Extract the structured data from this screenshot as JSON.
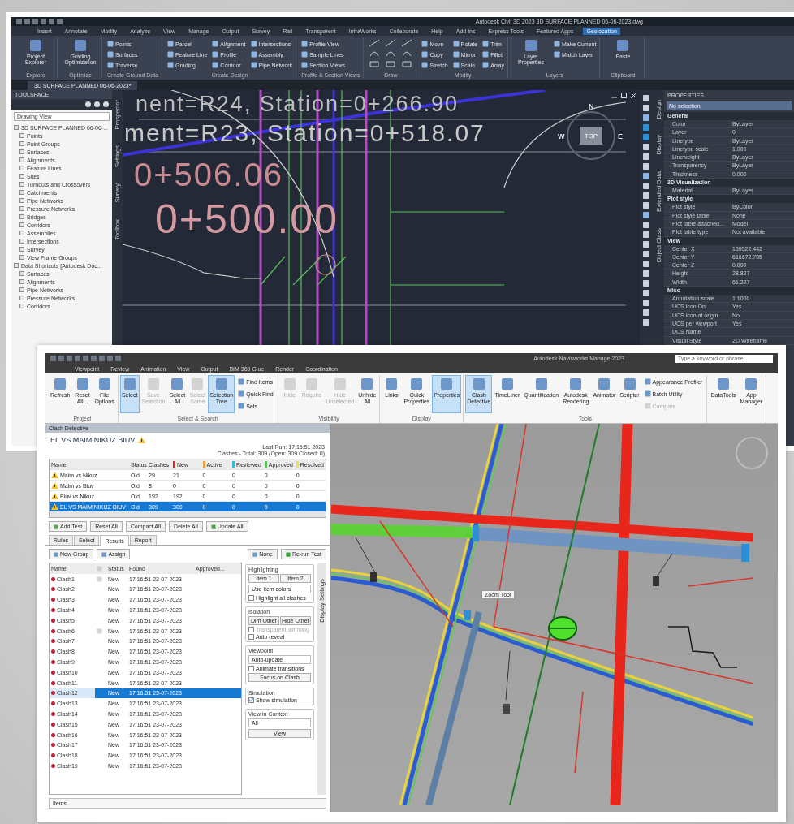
{
  "cad": {
    "title": "Autodesk Civil 3D 2023   3D SURFACE PLANNED 06-06-2023.dwg",
    "menu_tabs": [
      {
        "label": "Insert",
        "selected": false
      },
      {
        "label": "Annotate",
        "selected": false
      },
      {
        "label": "Modify",
        "selected": false
      },
      {
        "label": "Analyze",
        "selected": false
      },
      {
        "label": "View",
        "selected": false
      },
      {
        "label": "Manage",
        "selected": false
      },
      {
        "label": "Output",
        "selected": false
      },
      {
        "label": "Survey",
        "selected": false
      },
      {
        "label": "Rail",
        "selected": false
      },
      {
        "label": "Transparent",
        "selected": false
      },
      {
        "label": "InfraWorks",
        "selected": false
      },
      {
        "label": "Collaborate",
        "selected": false
      },
      {
        "label": "Help",
        "selected": false
      },
      {
        "label": "Add-ins",
        "selected": false
      },
      {
        "label": "Express Tools",
        "selected": false
      },
      {
        "label": "Featured Apps",
        "selected": false
      },
      {
        "label": "Geolocation",
        "selected": true
      }
    ],
    "ribbon_groups": [
      {
        "label": "Explore",
        "items": [
          {
            "label": "Project Explorer",
            "kind": "large"
          }
        ]
      },
      {
        "label": "Optimize",
        "items": [
          {
            "label": "Grading Optimization",
            "kind": "large"
          }
        ]
      },
      {
        "label": "Create Ground Data",
        "items": [
          {
            "label": "Points",
            "kind": "small"
          },
          {
            "label": "Surfaces",
            "kind": "small"
          },
          {
            "label": "Traverse",
            "kind": "small"
          }
        ]
      },
      {
        "label": "Create Design",
        "items": [
          {
            "label": "Parcel",
            "kind": "small"
          },
          {
            "label": "Feature Line",
            "kind": "small"
          },
          {
            "label": "Grading",
            "kind": "small"
          },
          {
            "label": "Alignment",
            "kind": "small"
          },
          {
            "label": "Profile",
            "kind": "small"
          },
          {
            "label": "Corridor",
            "kind": "small"
          },
          {
            "label": "Intersections",
            "kind": "small"
          },
          {
            "label": "Assembly",
            "kind": "small"
          },
          {
            "label": "Pipe Network",
            "kind": "small"
          }
        ]
      },
      {
        "label": "Profile & Section Views",
        "items": [
          {
            "label": "Profile View",
            "kind": "small"
          },
          {
            "label": "Sample Lines",
            "kind": "small"
          },
          {
            "label": "Section Views",
            "kind": "small"
          }
        ]
      },
      {
        "label": "Draw"
      },
      {
        "label": "Modify",
        "items": [
          {
            "label": "Move",
            "kind": "small"
          },
          {
            "label": "Copy",
            "kind": "small"
          },
          {
            "label": "Stretch",
            "kind": "small"
          },
          {
            "label": "Rotate",
            "kind": "small"
          },
          {
            "label": "Mirror",
            "kind": "small"
          },
          {
            "label": "Scale",
            "kind": "small"
          },
          {
            "label": "Trim",
            "kind": "small"
          },
          {
            "label": "Fillet",
            "kind": "small"
          },
          {
            "label": "Array",
            "kind": "small"
          }
        ]
      },
      {
        "label": "Layers",
        "items": [
          {
            "label": "Layer Properties",
            "kind": "large"
          },
          {
            "label": "Make Current",
            "kind": "small"
          },
          {
            "label": "Match Layer",
            "kind": "small"
          }
        ]
      },
      {
        "label": "Clipboard",
        "items": [
          {
            "label": "Paste",
            "kind": "large"
          }
        ]
      }
    ],
    "doc_tab": "3D SURFACE PLANNED 06-06-2023*",
    "toolspace": {
      "title": "TOOLSPACE",
      "view": "Drawing View",
      "tree": [
        {
          "label": "3D SURFACE PLANNED 06-06-...",
          "children": [
            {
              "label": "Points"
            },
            {
              "label": "Point Groups"
            },
            {
              "label": "Surfaces"
            },
            {
              "label": "Alignments"
            },
            {
              "label": "Feature Lines"
            },
            {
              "label": "Sites"
            },
            {
              "label": "Turnouts and Crossovers"
            },
            {
              "label": "Catchments"
            },
            {
              "label": "Pipe Networks"
            },
            {
              "label": "Pressure Networks"
            },
            {
              "label": "Bridges"
            },
            {
              "label": "Corridors"
            },
            {
              "label": "Assemblies"
            },
            {
              "label": "Intersections"
            },
            {
              "label": "Survey"
            },
            {
              "label": "View Frame Groups"
            }
          ]
        },
        {
          "label": "Data Shortcuts [Autodesk Doc...",
          "children": [
            {
              "label": "Surfaces"
            },
            {
              "label": "Alignments"
            },
            {
              "label": "Pipe Networks"
            },
            {
              "label": "Pressure Networks"
            },
            {
              "label": "Corridors"
            }
          ]
        }
      ],
      "side_tabs": [
        "Prospector",
        "Settings",
        "Survey",
        "Toolbox"
      ]
    },
    "canvas": {
      "labels": [
        {
          "text": "nent=R24, Station=0+266.90",
          "color": "#bdbdbd"
        },
        {
          "text": "ment=R23, Station=0+518.07",
          "color": "#c9c9c9"
        },
        {
          "text": "0+506.06",
          "color": "#c98a92"
        },
        {
          "text": "0+500.00",
          "color": "#d39aa2"
        }
      ],
      "viewcube": {
        "north": "N",
        "west": "W",
        "east": "E",
        "top": "TOP"
      }
    },
    "properties": {
      "title": "PROPERTIES",
      "selection": "No selection",
      "sections": [
        {
          "title": "General",
          "rows": [
            {
              "name": "Color",
              "value": "ByLayer"
            },
            {
              "name": "Layer",
              "value": "0"
            },
            {
              "name": "Linetype",
              "value": "ByLayer"
            },
            {
              "name": "Linetype scale",
              "value": "1.000"
            },
            {
              "name": "Lineweight",
              "value": "ByLayer"
            },
            {
              "name": "Transparency",
              "value": "ByLayer"
            },
            {
              "name": "Thickness",
              "value": "0.000"
            }
          ]
        },
        {
          "title": "3D Visualization",
          "rows": [
            {
              "name": "Material",
              "value": "ByLayer"
            }
          ]
        },
        {
          "title": "Plot style",
          "rows": [
            {
              "name": "Plot style",
              "value": "ByColor"
            },
            {
              "name": "Plot style table",
              "value": "None"
            },
            {
              "name": "Plot table attached...",
              "value": "Model"
            },
            {
              "name": "Plot table type",
              "value": "Not available"
            }
          ]
        },
        {
          "title": "View",
          "rows": [
            {
              "name": "Center X",
              "value": "159522.442"
            },
            {
              "name": "Center Y",
              "value": "616672.705"
            },
            {
              "name": "Center Z",
              "value": "0.000"
            },
            {
              "name": "Height",
              "value": "28.827"
            },
            {
              "name": "Width",
              "value": "61.227"
            }
          ]
        },
        {
          "title": "Misc",
          "rows": [
            {
              "name": "Annotation scale",
              "value": "1:1000"
            },
            {
              "name": "UCS icon On",
              "value": "Yes"
            },
            {
              "name": "UCS icon at origin",
              "value": "No"
            },
            {
              "name": "UCS per viewport",
              "value": "Yes"
            },
            {
              "name": "UCS Name"
            },
            {
              "name": "Visual Style",
              "value": "2D Wireframe"
            }
          ]
        }
      ],
      "side_tabs": [
        "Design",
        "Display",
        "Extended Data",
        "Object Class"
      ]
    }
  },
  "nav": {
    "title": "Autodesk Navisworks Manage 2023",
    "search": {
      "placeholder": "Type a keyword or phrase"
    },
    "tabs": [
      {
        "label": "Viewpoint",
        "selected": false
      },
      {
        "label": "Review",
        "selected": false
      },
      {
        "label": "Animation",
        "selected": false
      },
      {
        "label": "View",
        "selected": false
      },
      {
        "label": "Output",
        "selected": false
      },
      {
        "label": "BIM 360 Glue",
        "selected": false
      },
      {
        "label": "Render",
        "selected": false
      },
      {
        "label": "Coordination",
        "selected": false
      }
    ],
    "ribbon_groups": [
      {
        "label": "Project",
        "buttons": [
          {
            "label": "Refresh",
            "kind": "large",
            "selected": false,
            "disabled": false
          },
          {
            "label": "Reset All...",
            "kind": "large",
            "selected": false,
            "disabled": false
          },
          {
            "label": "File Options",
            "kind": "large",
            "selected": false,
            "disabled": false
          }
        ]
      },
      {
        "label": "Select & Search",
        "buttons": [
          {
            "label": "Select",
            "kind": "large",
            "selected": true,
            "disabled": false
          },
          {
            "label": "Save Selection",
            "kind": "large",
            "selected": false,
            "disabled": true
          },
          {
            "label": "Select All",
            "kind": "large",
            "selected": false,
            "disabled": false
          },
          {
            "label": "Select Same",
            "kind": "large",
            "selected": false,
            "disabled": true
          },
          {
            "label": "Selection Tree",
            "kind": "large",
            "selected": true,
            "disabled": false
          },
          {
            "label": "Find Items",
            "kind": "small",
            "selected": false,
            "disabled": false
          },
          {
            "label": "Quick Find",
            "kind": "small",
            "selected": false,
            "disabled": false
          },
          {
            "label": "Sets",
            "kind": "small",
            "selected": false,
            "disabled": false
          }
        ]
      },
      {
        "label": "Visibility",
        "buttons": [
          {
            "label": "Hide",
            "kind": "large",
            "selected": false,
            "disabled": true
          },
          {
            "label": "Require",
            "kind": "large",
            "selected": false,
            "disabled": true
          },
          {
            "label": "Hide Unselected",
            "kind": "large",
            "selected": false,
            "disabled": true
          },
          {
            "label": "Unhide All",
            "kind": "large",
            "selected": false,
            "disabled": false
          }
        ]
      },
      {
        "label": "Display",
        "buttons": [
          {
            "label": "Links",
            "kind": "large",
            "selected": false,
            "disabled": false
          },
          {
            "label": "Quick Properties",
            "kind": "large",
            "selected": false,
            "disabled": false
          },
          {
            "label": "Properties",
            "kind": "large",
            "selected": true,
            "disabled": false
          }
        ]
      },
      {
        "label": "Tools",
        "buttons": [
          {
            "label": "Clash Detective",
            "kind": "large",
            "selected": true,
            "disabled": false
          },
          {
            "label": "TimeLiner",
            "kind": "large",
            "selected": false,
            "disabled": false
          },
          {
            "label": "Quantification",
            "kind": "large",
            "selected": false,
            "disabled": false
          },
          {
            "label": "Autodesk Rendering",
            "kind": "large",
            "selected": false,
            "disabled": false
          },
          {
            "label": "Animator",
            "kind": "large",
            "selected": false,
            "disabled": false
          },
          {
            "label": "Scripter",
            "kind": "large",
            "selected": false,
            "disabled": false
          },
          {
            "label": "Appearance Profiler",
            "kind": "small",
            "selected": false,
            "disabled": false
          },
          {
            "label": "Batch Utility",
            "kind": "small",
            "selected": false,
            "disabled": false
          },
          {
            "label": "Compare",
            "kind": "small",
            "selected": false,
            "disabled": true
          }
        ]
      },
      {
        "buttons": [
          {
            "label": "DataTools",
            "kind": "large",
            "selected": false,
            "disabled": false
          },
          {
            "label": "App Manager",
            "kind": "large",
            "selected": false,
            "disabled": false
          }
        ]
      }
    ],
    "clash": {
      "panel_title": "Clash Detective",
      "test_name": "EL VS MAIM NIKUZ BIUV",
      "last_run": "Last Run:  17:16:51 2023",
      "summary": "Clashes - Total: 309  (Open: 309  Closed: 0)",
      "columns": [
        {
          "label": "Name"
        },
        {
          "label": "Status"
        },
        {
          "label": "Clashes"
        },
        {
          "label": "New",
          "color": "#d9262b"
        },
        {
          "label": "Active",
          "color": "#e8a33c"
        },
        {
          "label": "Reviewed",
          "color": "#3fb6d8"
        },
        {
          "label": "Approved",
          "color": "#5cc15a"
        },
        {
          "label": "Resolved",
          "color": "#efe05a"
        }
      ],
      "tests": [
        {
          "cells": [
            "Maim vs Nikuz",
            "Old",
            "29",
            "21",
            "0",
            "0",
            "0",
            "0"
          ],
          "selected": false
        },
        {
          "cells": [
            "Maim vs Biuv",
            "Old",
            "8",
            "0",
            "0",
            "0",
            "0",
            "0"
          ],
          "selected": false
        },
        {
          "cells": [
            "Biuv vs Nikuz",
            "Old",
            "192",
            "192",
            "0",
            "0",
            "0",
            "0"
          ],
          "selected": false
        },
        {
          "cells": [
            "EL VS MAIM NIKUZ BIUV",
            "Old",
            "309",
            "309",
            "0",
            "0",
            "0",
            "0"
          ],
          "selected": true
        }
      ],
      "test_buttons": [
        "Add Test",
        "Reset All",
        "Compact All",
        "Delete All",
        "Update All"
      ],
      "tabs": [
        {
          "label": "Rules",
          "selected": false
        },
        {
          "label": "Select",
          "selected": false
        },
        {
          "label": "Results",
          "selected": true
        },
        {
          "label": "Report",
          "selected": false
        }
      ],
      "toolbar": [
        "New Group",
        "Assign",
        "None",
        "Re-run Test"
      ],
      "result_columns": [
        "Name",
        "Status",
        "Found",
        "Approved..."
      ],
      "results": [
        {
          "name": "Clash1",
          "status": "New",
          "found": "17:16:51 23-07-2023",
          "comment": true,
          "selected": false
        },
        {
          "name": "Clash2",
          "status": "New",
          "found": "17:16:51 23-07-2023",
          "comment": false,
          "selected": false
        },
        {
          "name": "Clash3",
          "status": "New",
          "found": "17:16:51 23-07-2023",
          "comment": false,
          "selected": false
        },
        {
          "name": "Clash4",
          "status": "New",
          "found": "17:16:51 23-07-2023",
          "comment": false,
          "selected": false
        },
        {
          "name": "Clash5",
          "status": "New",
          "found": "17:16:51 23-07-2023",
          "comment": false,
          "selected": false
        },
        {
          "name": "Clash6",
          "status": "New",
          "found": "17:16:51 23-07-2023",
          "comment": true,
          "selected": false
        },
        {
          "name": "Clash7",
          "status": "New",
          "found": "17:16:51 23-07-2023",
          "comment": false,
          "selected": false
        },
        {
          "name": "Clash8",
          "status": "New",
          "found": "17:16:51 23-07-2023",
          "comment": false,
          "selected": false
        },
        {
          "name": "Clash9",
          "status": "New",
          "found": "17:16:51 23-07-2023",
          "comment": false,
          "selected": false
        },
        {
          "name": "Clash10",
          "status": "New",
          "found": "17:16:51 23-07-2023",
          "comment": false,
          "selected": false
        },
        {
          "name": "Clash11",
          "status": "New",
          "found": "17:16:51 23-07-2023",
          "comment": false,
          "selected": false
        },
        {
          "name": "Clash12",
          "status": "New",
          "found": "17:16:51 23-07-2023",
          "comment": false,
          "selected": true
        },
        {
          "name": "Clash13",
          "status": "New",
          "found": "17:16:51 23-07-2023",
          "comment": false,
          "selected": false
        },
        {
          "name": "Clash14",
          "status": "New",
          "found": "17:16:51 23-07-2023",
          "comment": false,
          "selected": false
        },
        {
          "name": "Clash15",
          "status": "New",
          "found": "17:16:51 23-07-2023",
          "comment": false,
          "selected": false
        },
        {
          "name": "Clash16",
          "status": "New",
          "found": "17:16:51 23-07-2023",
          "comment": false,
          "selected": false
        },
        {
          "name": "Clash17",
          "status": "New",
          "found": "17:16:51 23-07-2023",
          "comment": false,
          "selected": false
        },
        {
          "name": "Clash18",
          "status": "New",
          "found": "17:16:51 23-07-2023",
          "comment": false,
          "selected": false
        },
        {
          "name": "Clash19",
          "status": "New",
          "found": "17:16:51 23-07-2023",
          "comment": false,
          "selected": false
        }
      ],
      "options": [
        {
          "title": "Highlighting",
          "items": [
            {
              "kind": "pair",
              "labels": [
                "Item 1",
                "Item 2"
              ]
            },
            {
              "kind": "select",
              "label": "Use item colors"
            },
            {
              "kind": "checkbox",
              "label": "Highlight all clashes",
              "checked": false,
              "disabled": false
            }
          ]
        },
        {
          "title": "Isolation",
          "items": [
            {
              "kind": "pair",
              "labels": [
                "Dim Other",
                "Hide Other"
              ]
            },
            {
              "kind": "checkbox",
              "label": "Transparent dimming",
              "checked": false,
              "disabled": true
            },
            {
              "kind": "checkbox",
              "label": "Auto reveal",
              "checked": false,
              "disabled": false
            }
          ]
        },
        {
          "title": "Viewpoint",
          "items": [
            {
              "kind": "select",
              "label": "Auto-update"
            },
            {
              "kind": "checkbox",
              "label": "Animate transitions",
              "checked": false,
              "disabled": false
            },
            {
              "kind": "button",
              "label": "Focus on Clash"
            }
          ]
        },
        {
          "title": "Simulation",
          "items": [
            {
              "kind": "checkbox",
              "label": "Show simulation",
              "checked": true,
              "disabled": false
            }
          ]
        },
        {
          "title": "View in Context",
          "items": [
            {
              "kind": "select",
              "label": "All"
            },
            {
              "kind": "button",
              "label": "View"
            }
          ]
        }
      ],
      "options_tab": "Display Settings",
      "items_bar": "Items"
    },
    "view": {
      "tooltip": "Zoom Tool"
    }
  }
}
